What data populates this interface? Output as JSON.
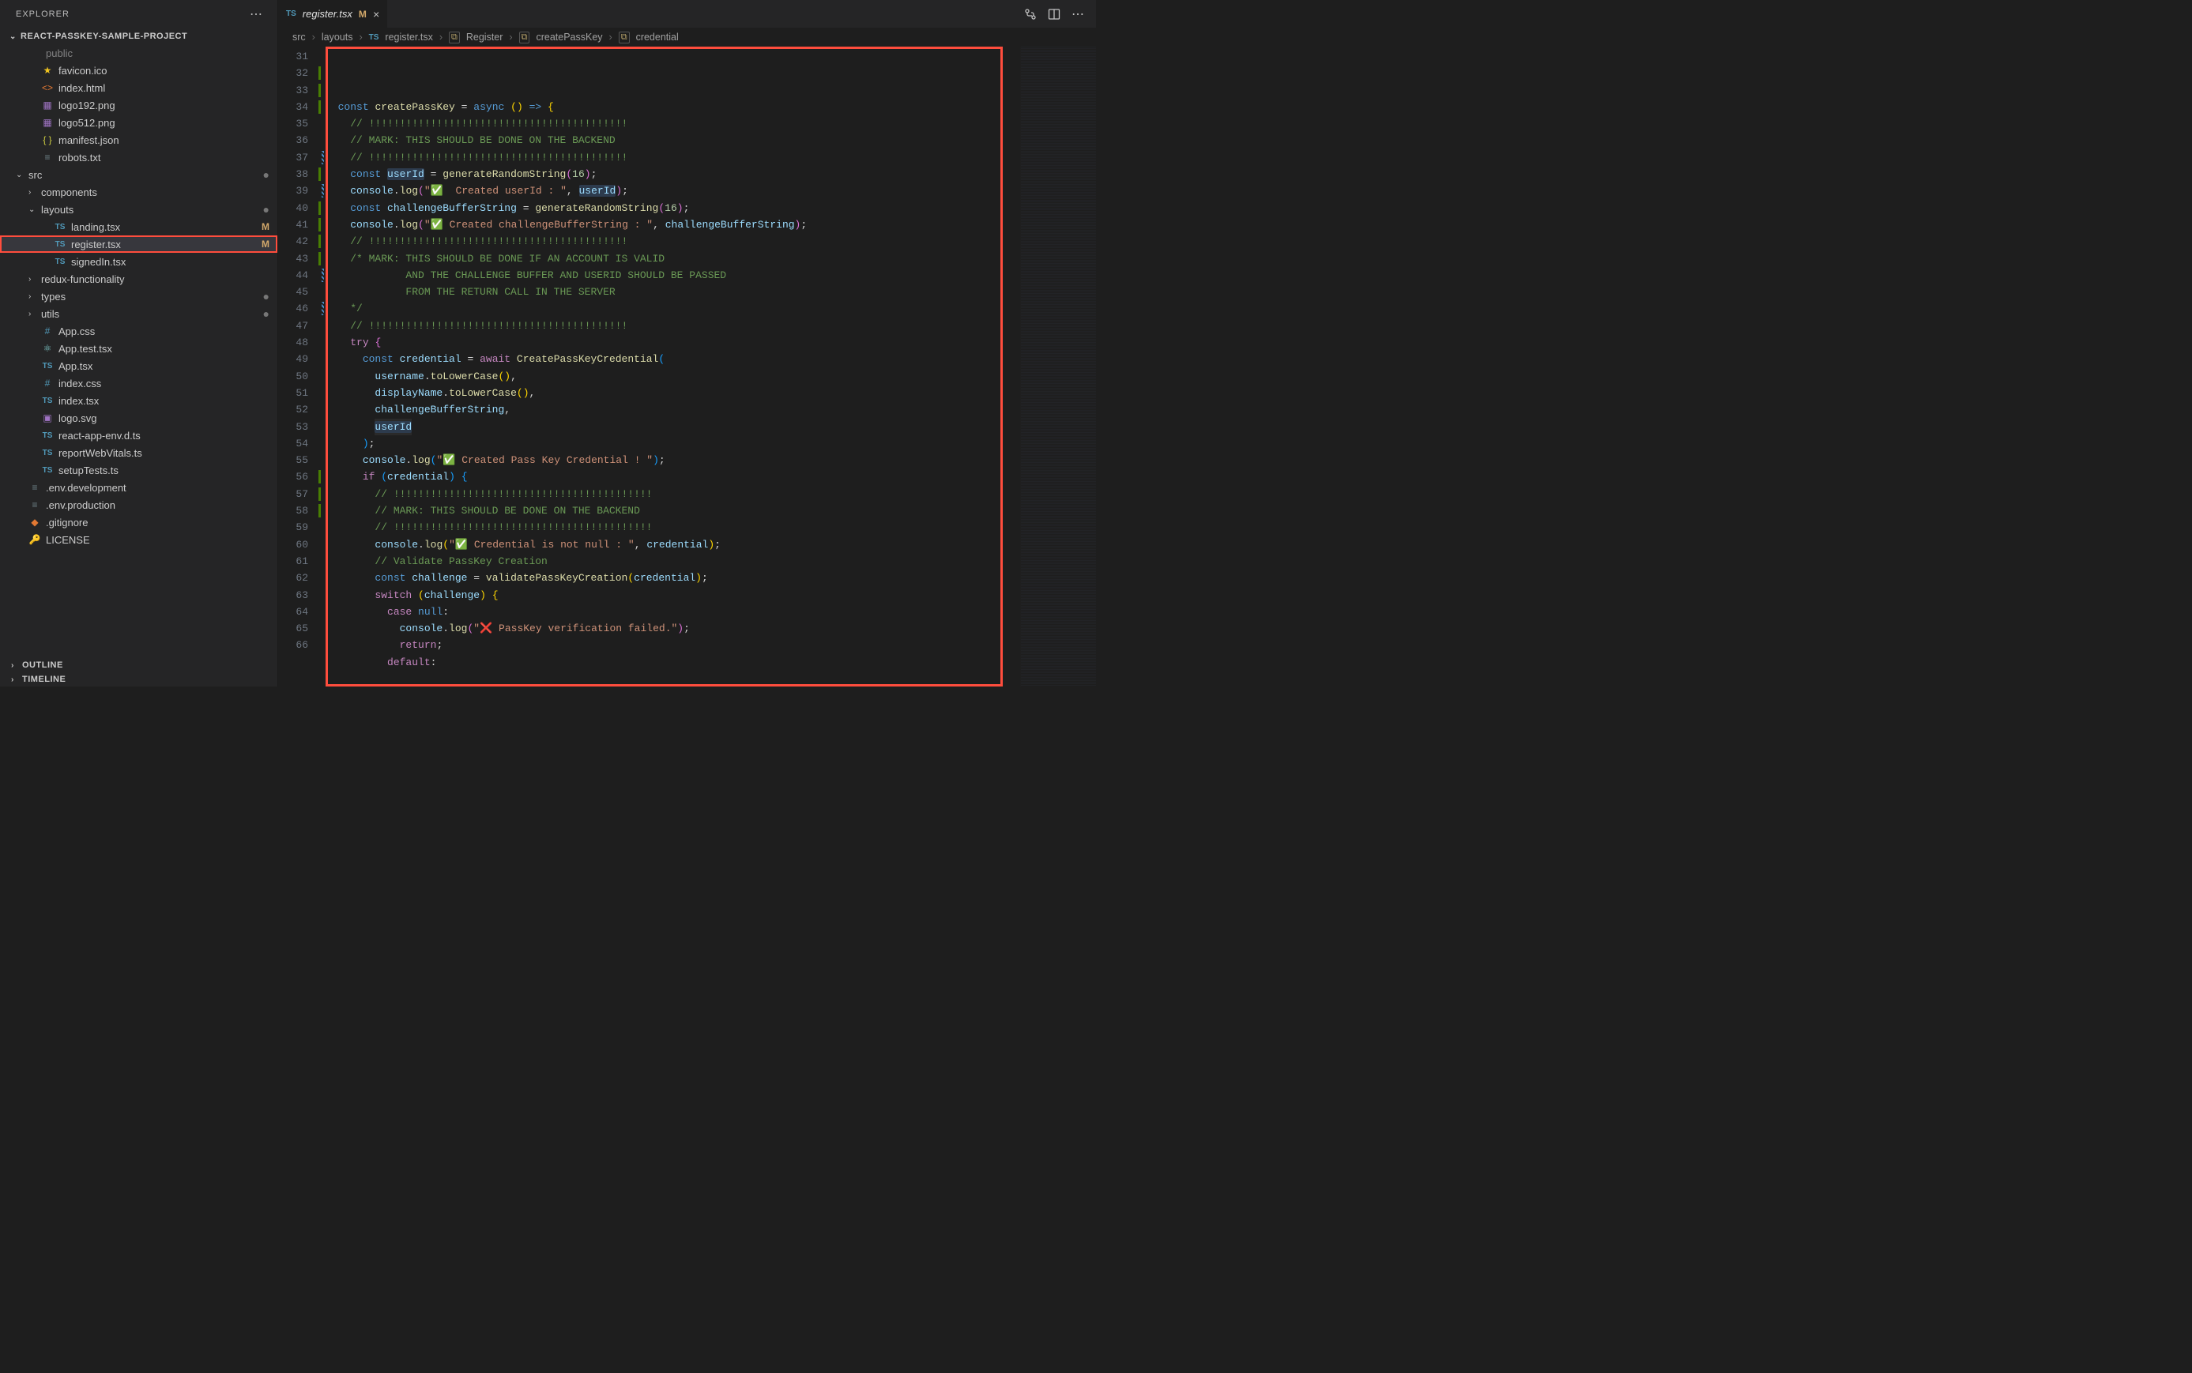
{
  "explorer": {
    "title": "EXPLORER"
  },
  "project": {
    "name": "REACT-PASSKEY-SAMPLE-PROJECT"
  },
  "outline": {
    "title": "OUTLINE"
  },
  "timeline": {
    "title": "TIMELINE"
  },
  "tree": [
    {
      "depth": 0,
      "chev": "",
      "icon": "folder",
      "label": "public",
      "dim": true
    },
    {
      "depth": 1,
      "icon": "star",
      "label": "favicon.ico"
    },
    {
      "depth": 1,
      "icon": "html",
      "label": "index.html"
    },
    {
      "depth": 1,
      "icon": "img",
      "label": "logo192.png"
    },
    {
      "depth": 1,
      "icon": "img",
      "label": "logo512.png"
    },
    {
      "depth": 1,
      "icon": "json",
      "label": "manifest.json"
    },
    {
      "depth": 1,
      "icon": "txt",
      "label": "robots.txt"
    },
    {
      "depth": 0,
      "chev": "v",
      "icon": "",
      "label": "src",
      "status": "dot"
    },
    {
      "depth": 1,
      "chev": ">",
      "label": "components"
    },
    {
      "depth": 1,
      "chev": "v",
      "label": "layouts",
      "status": "dot"
    },
    {
      "depth": 2,
      "icon": "ts",
      "label": "landing.tsx",
      "status": "M"
    },
    {
      "depth": 2,
      "icon": "ts",
      "label": "register.tsx",
      "status": "M",
      "selected": true,
      "highlighted": true
    },
    {
      "depth": 2,
      "icon": "ts",
      "label": "signedIn.tsx"
    },
    {
      "depth": 1,
      "chev": ">",
      "label": "redux-functionality"
    },
    {
      "depth": 1,
      "chev": ">",
      "label": "types",
      "status": "dot"
    },
    {
      "depth": 1,
      "chev": ">",
      "label": "utils",
      "status": "dot"
    },
    {
      "depth": 1,
      "icon": "css",
      "label": "App.css"
    },
    {
      "depth": 1,
      "icon": "react",
      "label": "App.test.tsx"
    },
    {
      "depth": 1,
      "icon": "ts",
      "label": "App.tsx"
    },
    {
      "depth": 1,
      "icon": "css",
      "label": "index.css"
    },
    {
      "depth": 1,
      "icon": "ts",
      "label": "index.tsx"
    },
    {
      "depth": 1,
      "icon": "svg",
      "label": "logo.svg"
    },
    {
      "depth": 1,
      "icon": "ts",
      "label": "react-app-env.d.ts"
    },
    {
      "depth": 1,
      "icon": "ts",
      "label": "reportWebVitals.ts"
    },
    {
      "depth": 1,
      "icon": "ts",
      "label": "setupTests.ts"
    },
    {
      "depth": 0,
      "icon": "env",
      "label": ".env.development"
    },
    {
      "depth": 0,
      "icon": "env",
      "label": ".env.production"
    },
    {
      "depth": 0,
      "icon": "git",
      "label": ".gitignore"
    },
    {
      "depth": 0,
      "icon": "lic",
      "label": "LICENSE"
    }
  ],
  "tab": {
    "filename": "register.tsx",
    "badge": "M"
  },
  "breadcrumbs": {
    "p1": "src",
    "p2": "layouts",
    "p3": "register.tsx",
    "p4": "Register",
    "p5": "createPassKey",
    "p6": "credential"
  },
  "line_start": 31,
  "line_end": 66,
  "code_lines": [
    {
      "html": "  <span class='tk-kw2'>const</span> <span class='tk-fn'>createPassKey</span> <span class='tk-pn'>=</span> <span class='tk-kw2'>async</span> <span class='tk-ylw'>(</span><span class='tk-ylw'>)</span> <span class='tk-kw2'>=></span> <span class='tk-ylw'>{</span>"
    },
    {
      "html": "    <span class='tk-cmt'>// !!!!!!!!!!!!!!!!!!!!!!!!!!!!!!!!!!!!!!!!!!</span>"
    },
    {
      "html": "    <span class='tk-cmt'>// MARK: THIS SHOULD BE DONE ON THE BACKEND</span>"
    },
    {
      "html": "    <span class='tk-cmt'>// !!!!!!!!!!!!!!!!!!!!!!!!!!!!!!!!!!!!!!!!!!</span>"
    },
    {
      "html": "    <span class='tk-kw2'>const</span> <span class='tk-var-hl'>userId</span> <span class='tk-pn'>=</span> <span class='tk-fn'>generateRandomString</span><span class='tk-pnk'>(</span><span class='tk-num'>16</span><span class='tk-pnk'>)</span><span class='tk-pn'>;</span>"
    },
    {
      "html": "    <span class='tk-var'>console</span><span class='tk-pn'>.</span><span class='tk-fn'>log</span><span class='tk-pnk'>(</span><span class='tk-str'>\"✅  Created userId : \"</span><span class='tk-pn'>,</span> <span class='tk-var-hl'>userId</span><span class='tk-pnk'>)</span><span class='tk-pn'>;</span>"
    },
    {
      "html": "    <span class='tk-kw2'>const</span> <span class='tk-var'>challengeBufferString</span> <span class='tk-pn'>=</span> <span class='tk-fn'>generateRandomString</span><span class='tk-pnk'>(</span><span class='tk-num'>16</span><span class='tk-pnk'>)</span><span class='tk-pn'>;</span>"
    },
    {
      "html": "    <span class='tk-var'>console</span><span class='tk-pn'>.</span><span class='tk-fn'>log</span><span class='tk-pnk'>(</span><span class='tk-str'>\"✅ Created challengeBufferString : \"</span><span class='tk-pn'>,</span> <span class='tk-var'>challengeBufferString</span><span class='tk-pnk'>)</span><span class='tk-pn'>;</span>"
    },
    {
      "html": "    <span class='tk-cmt'>// !!!!!!!!!!!!!!!!!!!!!!!!!!!!!!!!!!!!!!!!!!</span>"
    },
    {
      "html": "    <span class='tk-cmt'>/* MARK: THIS SHOULD BE DONE IF AN ACCOUNT IS VALID</span>"
    },
    {
      "html": "    <span class='tk-cmt'>         AND THE CHALLENGE BUFFER AND USERID SHOULD BE PASSED</span>"
    },
    {
      "html": "    <span class='tk-cmt'>         FROM THE RETURN CALL IN THE SERVER</span>"
    },
    {
      "html": "    <span class='tk-cmt'>*/</span>"
    },
    {
      "html": "    <span class='tk-cmt'>// !!!!!!!!!!!!!!!!!!!!!!!!!!!!!!!!!!!!!!!!!!</span>"
    },
    {
      "html": "    <span class='tk-kw'>try</span> <span class='tk-pnk'>{</span>"
    },
    {
      "html": "      <span class='tk-kw2'>const</span> <span class='tk-var'>credential</span> <span class='tk-pn'>=</span> <span class='tk-kw'>await</span> <span class='tk-fn'>CreatePassKeyCredential</span><span class='tk-blu'>(</span>"
    },
    {
      "html": "        <span class='tk-var'>username</span><span class='tk-pn'>.</span><span class='tk-fn'>toLowerCase</span><span class='tk-ylw'>(</span><span class='tk-ylw'>)</span><span class='tk-pn'>,</span>"
    },
    {
      "html": "        <span class='tk-var'>displayName</span><span class='tk-pn'>.</span><span class='tk-fn'>toLowerCase</span><span class='tk-ylw'>(</span><span class='tk-ylw'>)</span><span class='tk-pn'>,</span>"
    },
    {
      "html": "        <span class='tk-var'>challengeBufferString</span><span class='tk-pn'>,</span>"
    },
    {
      "html": "        <span class='cursor-line'><span class='tk-var-hl'>userId</span></span>"
    },
    {
      "html": "      <span class='tk-blu'>)</span><span class='tk-pn'>;</span>"
    },
    {
      "html": ""
    },
    {
      "html": "      <span class='tk-var'>console</span><span class='tk-pn'>.</span><span class='tk-fn'>log</span><span class='tk-blu'>(</span><span class='tk-str'>\"✅ Created Pass Key Credential ! \"</span><span class='tk-blu'>)</span><span class='tk-pn'>;</span>"
    },
    {
      "html": ""
    },
    {
      "html": "      <span class='tk-kw'>if</span> <span class='tk-blu'>(</span><span class='tk-var'>credential</span><span class='tk-blu'>)</span> <span class='tk-blu'>{</span>"
    },
    {
      "html": "        <span class='tk-cmt'>// !!!!!!!!!!!!!!!!!!!!!!!!!!!!!!!!!!!!!!!!!!</span>"
    },
    {
      "html": "        <span class='tk-cmt'>// MARK: THIS SHOULD BE DONE ON THE BACKEND</span>"
    },
    {
      "html": "        <span class='tk-cmt'>// !!!!!!!!!!!!!!!!!!!!!!!!!!!!!!!!!!!!!!!!!!</span>"
    },
    {
      "html": "        <span class='tk-var'>console</span><span class='tk-pn'>.</span><span class='tk-fn'>log</span><span class='tk-ylw'>(</span><span class='tk-str'>\"✅ Credential is not null : \"</span><span class='tk-pn'>,</span> <span class='tk-var'>credential</span><span class='tk-ylw'>)</span><span class='tk-pn'>;</span>"
    },
    {
      "html": "        <span class='tk-cmt'>// Validate PassKey Creation</span>"
    },
    {
      "html": "        <span class='tk-kw2'>const</span> <span class='tk-var'>challenge</span> <span class='tk-pn'>=</span> <span class='tk-fn'>validatePassKeyCreation</span><span class='tk-ylw'>(</span><span class='tk-var'>credential</span><span class='tk-ylw'>)</span><span class='tk-pn'>;</span>"
    },
    {
      "html": "        <span class='tk-kw'>switch</span> <span class='tk-ylw'>(</span><span class='tk-var'>challenge</span><span class='tk-ylw'>)</span> <span class='tk-ylw'>{</span>"
    },
    {
      "html": "          <span class='tk-kw'>case</span> <span class='tk-kw2'>null</span><span class='tk-pn'>:</span>"
    },
    {
      "html": "            <span class='tk-var'>console</span><span class='tk-pn'>.</span><span class='tk-fn'>log</span><span class='tk-pnk'>(</span><span class='tk-str'>\"❌ PassKey verification failed.\"</span><span class='tk-pnk'>)</span><span class='tk-pn'>;</span>"
    },
    {
      "html": "            <span class='tk-kw'>return</span><span class='tk-pn'>;</span>"
    },
    {
      "html": "          <span class='tk-kw'>default</span><span class='tk-pn'>:</span>"
    }
  ],
  "mod_lines": [
    32,
    33,
    34,
    38,
    40,
    41,
    42,
    43,
    56,
    57,
    58
  ],
  "diag_lines": [
    37,
    39,
    44,
    46
  ]
}
